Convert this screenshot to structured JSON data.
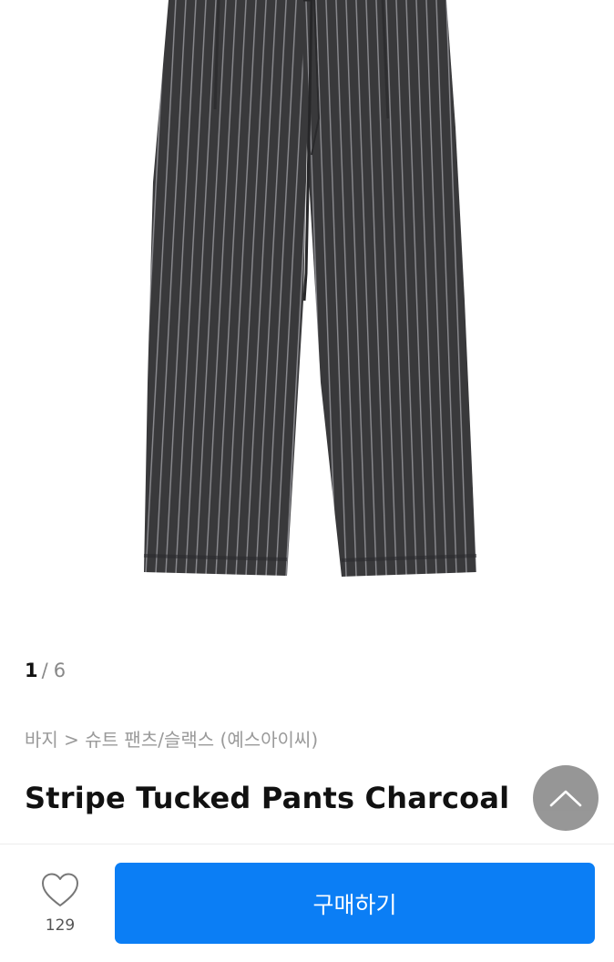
{
  "gallery": {
    "current": "1",
    "separator": "/",
    "total": "6"
  },
  "breadcrumb": "바지 > 슈트 팬츠/슬랙스 (예스아이씨)",
  "product": {
    "title": "Stripe Tucked Pants Charcoal"
  },
  "footer": {
    "like_count": "129",
    "buy_label": "구매하기"
  },
  "colors": {
    "accent": "#0b7ef5",
    "fabric": "#38383a",
    "stripe": "#8f8f93"
  },
  "icons": [
    "chevron-up-icon",
    "heart-icon"
  ]
}
